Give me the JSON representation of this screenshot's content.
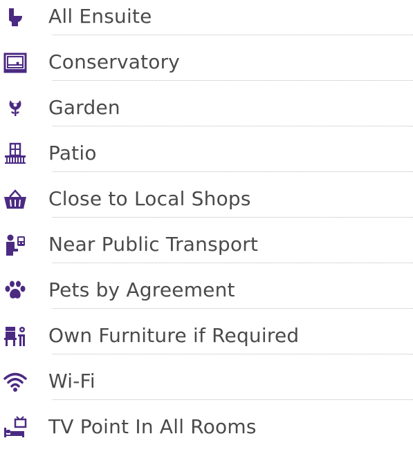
{
  "colors": {
    "icon": "#4b2a82",
    "text": "#4a4a4a",
    "divider": "#b9b9b9"
  },
  "features": [
    {
      "label": "All Ensuite",
      "icon": "toilet-icon"
    },
    {
      "label": "Conservatory",
      "icon": "conservatory-icon"
    },
    {
      "label": "Garden",
      "icon": "flower-icon"
    },
    {
      "label": "Patio",
      "icon": "patio-icon"
    },
    {
      "label": "Close to Local Shops",
      "icon": "shopping-basket-icon"
    },
    {
      "label": "Near Public Transport",
      "icon": "bus-passenger-icon"
    },
    {
      "label": "Pets by Agreement",
      "icon": "paw-icon"
    },
    {
      "label": "Own Furniture if Required",
      "icon": "furniture-icon"
    },
    {
      "label": "Wi-Fi",
      "icon": "wifi-icon"
    },
    {
      "label": "TV Point In All Rooms",
      "icon": "tv-bed-icon"
    }
  ]
}
